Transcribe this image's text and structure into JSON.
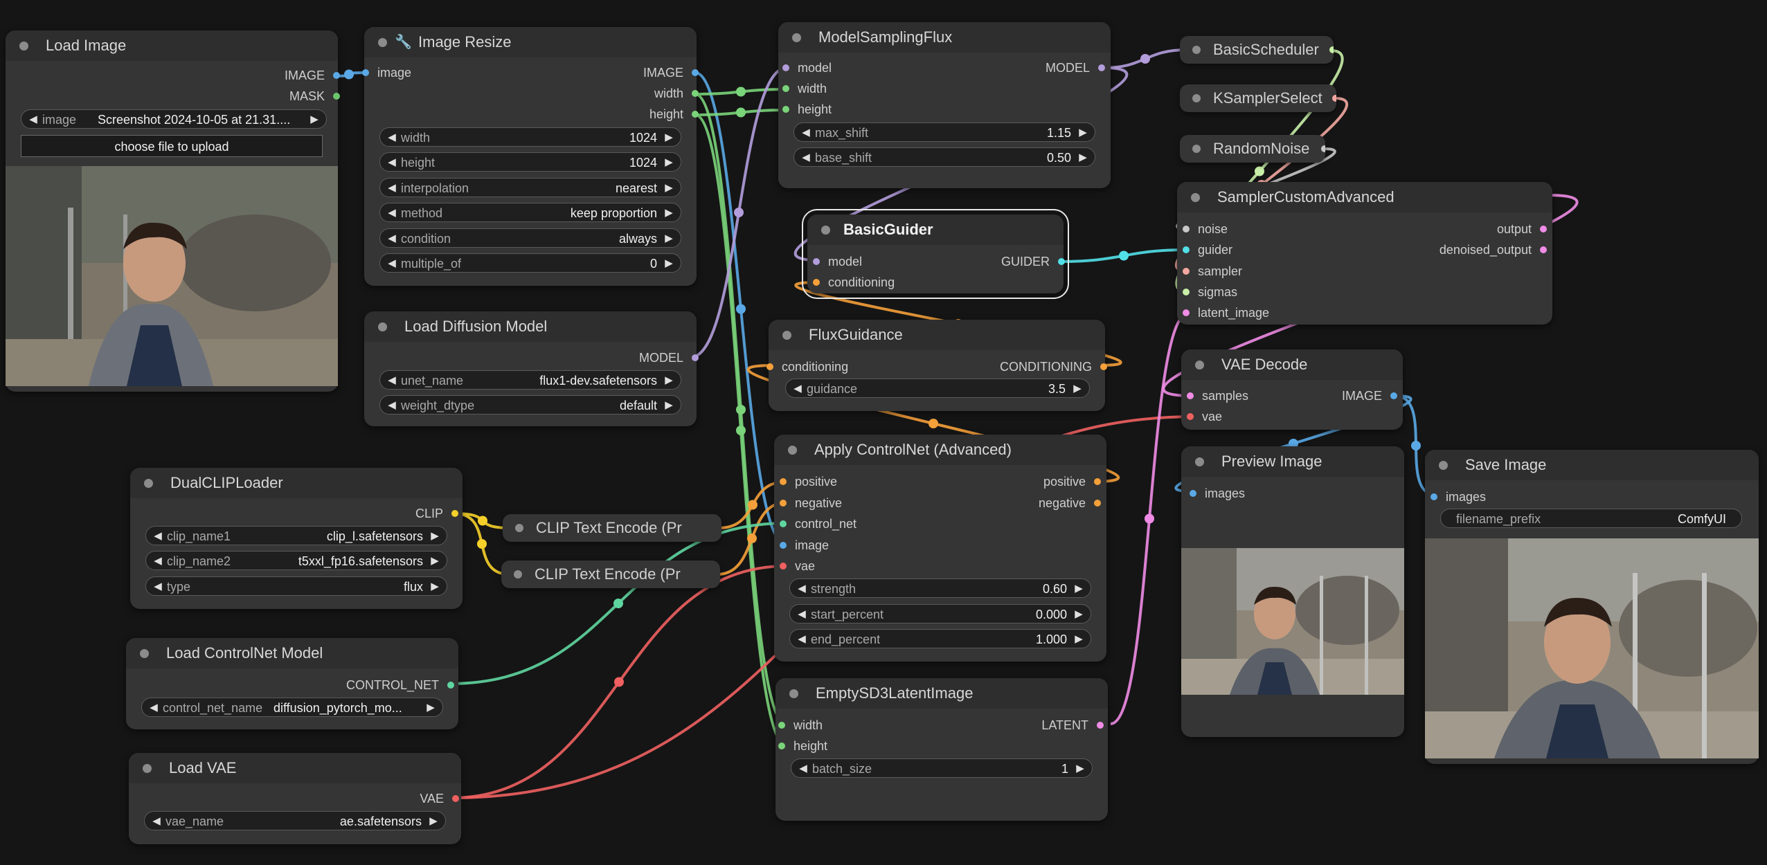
{
  "colors": {
    "image": "#5aa9e6",
    "mask": "#6bc56b",
    "int": "#7ad47a",
    "model": "#b39ddb",
    "clip": "#f5d02a",
    "conditioning": "#f5a03a",
    "control_net": "#5fd6a0",
    "vae": "#f06060",
    "latent": "#f08ce6",
    "guider": "#52e0e8",
    "sampler": "#f2a7a0",
    "sigmas": "#c8f0a8",
    "noise": "#c8c8c8"
  },
  "nodes": {
    "load_image": {
      "title": "Load Image",
      "out_image": "IMAGE",
      "out_mask": "MASK",
      "widget_image_label": "image",
      "widget_image_value": "Screenshot 2024-10-05 at 21.31....",
      "upload_label": "choose file to upload"
    },
    "image_resize": {
      "title": "Image Resize",
      "in_image": "image",
      "out_image": "IMAGE",
      "out_width": "width",
      "out_height": "height",
      "widgets": [
        {
          "label": "width",
          "value": "1024"
        },
        {
          "label": "height",
          "value": "1024"
        },
        {
          "label": "interpolation",
          "value": "nearest"
        },
        {
          "label": "method",
          "value": "keep proportion"
        },
        {
          "label": "condition",
          "value": "always"
        },
        {
          "label": "multiple_of",
          "value": "0"
        }
      ]
    },
    "model_sampling_flux": {
      "title": "ModelSamplingFlux",
      "in_model": "model",
      "in_width": "width",
      "in_height": "height",
      "out_model": "MODEL",
      "widgets": [
        {
          "label": "max_shift",
          "value": "1.15"
        },
        {
          "label": "base_shift",
          "value": "0.50"
        }
      ]
    },
    "basic_guider": {
      "title": "BasicGuider",
      "in_model": "model",
      "in_conditioning": "conditioning",
      "out_guider": "GUIDER"
    },
    "load_diffusion_model": {
      "title": "Load Diffusion Model",
      "out_model": "MODEL",
      "widgets": [
        {
          "label": "unet_name",
          "value": "flux1-dev.safetensors"
        },
        {
          "label": "weight_dtype",
          "value": "default"
        }
      ]
    },
    "flux_guidance": {
      "title": "FluxGuidance",
      "in_conditioning": "conditioning",
      "out_conditioning": "CONDITIONING",
      "widgets": [
        {
          "label": "guidance",
          "value": "3.5"
        }
      ]
    },
    "dual_clip_loader": {
      "title": "DualCLIPLoader",
      "out_clip": "CLIP",
      "widgets": [
        {
          "label": "clip_name1",
          "value": "clip_l.safetensors"
        },
        {
          "label": "clip_name2",
          "value": "t5xxl_fp16.safetensors"
        },
        {
          "label": "type",
          "value": "flux"
        }
      ]
    },
    "clip_text_encode_1": {
      "title": "CLIP Text Encode (Pr"
    },
    "clip_text_encode_2": {
      "title": "CLIP Text Encode (Pr"
    },
    "load_controlnet": {
      "title": "Load ControlNet Model",
      "out_control_net": "CONTROL_NET",
      "widgets": [
        {
          "label": "control_net_name",
          "value": "diffusion_pytorch_mo..."
        }
      ]
    },
    "load_vae": {
      "title": "Load VAE",
      "out_vae": "VAE",
      "widgets": [
        {
          "label": "vae_name",
          "value": "ae.safetensors"
        }
      ]
    },
    "apply_controlnet": {
      "title": "Apply ControlNet (Advanced)",
      "in_positive": "positive",
      "in_negative": "negative",
      "in_control_net": "control_net",
      "in_image": "image",
      "in_vae": "vae",
      "out_positive": "positive",
      "out_negative": "negative",
      "widgets": [
        {
          "label": "strength",
          "value": "0.60"
        },
        {
          "label": "start_percent",
          "value": "0.000"
        },
        {
          "label": "end_percent",
          "value": "1.000"
        }
      ]
    },
    "empty_sd3_latent": {
      "title": "EmptySD3LatentImage",
      "in_width": "width",
      "in_height": "height",
      "out_latent": "LATENT",
      "widgets": [
        {
          "label": "batch_size",
          "value": "1"
        }
      ]
    },
    "basic_scheduler": {
      "title": "BasicScheduler"
    },
    "ksampler_select": {
      "title": "KSamplerSelect"
    },
    "random_noise": {
      "title": "RandomNoise"
    },
    "sampler_custom_advanced": {
      "title": "SamplerCustomAdvanced",
      "in_noise": "noise",
      "in_guider": "guider",
      "in_sampler": "sampler",
      "in_sigmas": "sigmas",
      "in_latent": "latent_image",
      "out_output": "output",
      "out_denoised": "denoised_output"
    },
    "vae_decode": {
      "title": "VAE Decode",
      "in_samples": "samples",
      "in_vae": "vae",
      "out_image": "IMAGE"
    },
    "preview_image": {
      "title": "Preview Image",
      "in_images": "images"
    },
    "save_image": {
      "title": "Save Image",
      "in_images": "images",
      "widgets": [
        {
          "label": "filename_prefix",
          "value": "ComfyUI"
        }
      ]
    }
  }
}
